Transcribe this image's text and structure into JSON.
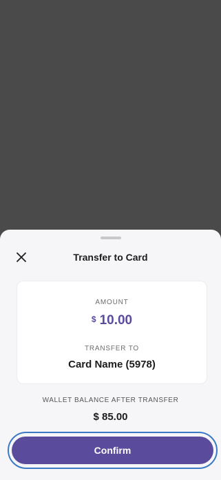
{
  "sheet": {
    "title": "Transfer to Card",
    "close_icon": "close-icon"
  },
  "summary": {
    "amount_label": "AMOUNT",
    "amount_currency": "$",
    "amount_value": "10.00",
    "transfer_to_label": "TRANSFER TO",
    "transfer_to_value": "Card Name (5978)"
  },
  "balance": {
    "label": "WALLET BALANCE AFTER TRANSFER",
    "value": "$ 85.00"
  },
  "actions": {
    "confirm_label": "Confirm"
  },
  "colors": {
    "accent": "#5b4b9c",
    "focus_ring": "#3b79c4",
    "backdrop": "#4a4a4a",
    "sheet_background": "#f6f6f8"
  }
}
